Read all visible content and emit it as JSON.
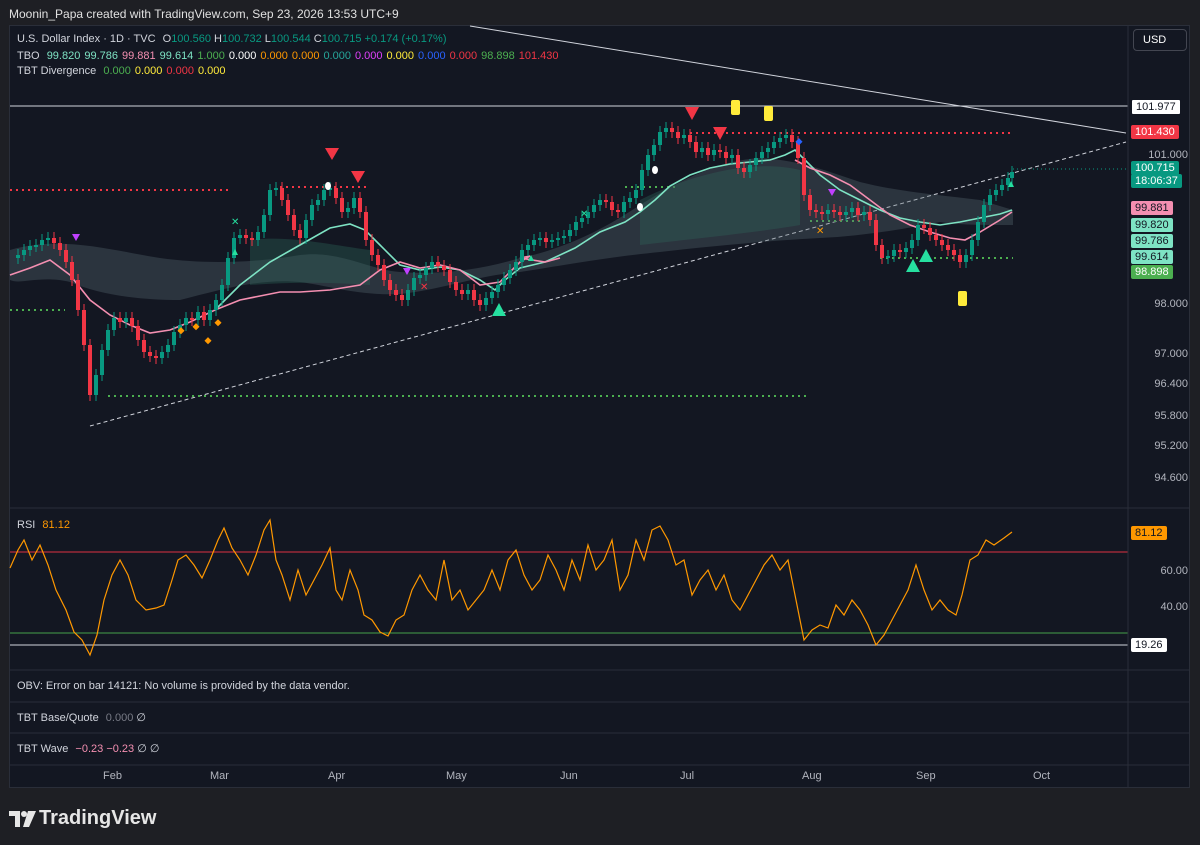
{
  "header": {
    "credit": "Moonin_Papa created with TradingView.com, Sep 23, 2026 13:53 UTC+9"
  },
  "main_legend": {
    "symbol": "U.S. Dollar Index · 1D · TVC",
    "open_label": "O",
    "open": "100.560",
    "high_label": "H",
    "high": "100.732",
    "low_label": "L",
    "low": "100.544",
    "close_label": "C",
    "close": "100.715",
    "change": "+0.174 (+0.17%)"
  },
  "tbo_legend": {
    "name": "TBO",
    "values": [
      {
        "v": "99.820",
        "color": "#7ee3c4"
      },
      {
        "v": "99.786",
        "color": "#7ee3c4"
      },
      {
        "v": "99.881",
        "color": "#f48fb1"
      },
      {
        "v": "99.614",
        "color": "#7ee3c4"
      },
      {
        "v": "1.000",
        "color": "#4caf50"
      },
      {
        "v": "0.000",
        "color": "#ffffff"
      },
      {
        "v": "0.000",
        "color": "#ff9800"
      },
      {
        "v": "0.000",
        "color": "#ff9800"
      },
      {
        "v": "0.000",
        "color": "#26a69a"
      },
      {
        "v": "0.000",
        "color": "#e040fb"
      },
      {
        "v": "0.000",
        "color": "#ffeb3b"
      },
      {
        "v": "0.000",
        "color": "#2962ff"
      },
      {
        "v": "0.000",
        "color": "#f23645"
      },
      {
        "v": "98.898",
        "color": "#4caf50"
      },
      {
        "v": "101.430",
        "color": "#f23645"
      }
    ]
  },
  "div_legend": {
    "name": "TBT Divergence",
    "values": [
      {
        "v": "0.000",
        "color": "#4caf50"
      },
      {
        "v": "0.000",
        "color": "#ffeb3b"
      },
      {
        "v": "0.000",
        "color": "#f23645"
      },
      {
        "v": "0.000",
        "color": "#ffeb3b"
      }
    ]
  },
  "currency_button": "USD",
  "price_scale": [
    "101.000",
    "98.000",
    "97.000",
    "96.400",
    "95.800",
    "95.200",
    "94.600"
  ],
  "price_tags": [
    {
      "v": "101.977",
      "bg": "#ffffff",
      "fg": "#131722",
      "border": "#131722"
    },
    {
      "v": "101.430",
      "bg": "#f23645",
      "fg": "#ffffff",
      "border": "#f23645"
    },
    {
      "v": "100.715",
      "bg": "#089981",
      "fg": "#ffffff",
      "border": "#089981"
    },
    {
      "v": "18:06:37",
      "bg": "#089981",
      "fg": "#ffffff",
      "border": "#089981"
    },
    {
      "v": "99.881",
      "bg": "#f48fb1",
      "fg": "#131722",
      "border": "#f48fb1"
    },
    {
      "v": "99.820",
      "bg": "#7ee3c4",
      "fg": "#131722",
      "border": "#7ee3c4"
    },
    {
      "v": "99.786",
      "bg": "#7ee3c4",
      "fg": "#131722",
      "border": "#7ee3c4"
    },
    {
      "v": "99.614",
      "bg": "#7ee3c4",
      "fg": "#131722",
      "border": "#7ee3c4"
    },
    {
      "v": "98.898",
      "bg": "#4caf50",
      "fg": "#ffffff",
      "border": "#4caf50"
    }
  ],
  "rsi": {
    "name": "RSI",
    "value": "81.12",
    "scale": [
      "60.00",
      "40.00"
    ],
    "low_tag": "19.26",
    "color": "#ff9800"
  },
  "obv": {
    "text": "OBV: Error on bar 14121: No volume is provided by the data vendor."
  },
  "base_quote": {
    "name": "TBT Base/Quote",
    "v1": "0.000",
    "v2": "∅"
  },
  "wave": {
    "name": "TBT Wave",
    "v1": "−0.23",
    "v2": "−0.23",
    "v3": "∅",
    "v4": "∅"
  },
  "time_axis": [
    "Feb",
    "Mar",
    "Apr",
    "May",
    "Jun",
    "Jul",
    "Aug",
    "Sep",
    "Oct"
  ],
  "brand": {
    "name": "TradingView"
  },
  "colors": {
    "up": "#089981",
    "down": "#f23645",
    "ribbon_upper": "#7ee3c4",
    "ribbon_lower": "#f48fb1",
    "rsi": "#ff9800",
    "support": "#4caf50",
    "resistance": "#f23645"
  },
  "chart_data": {
    "type": "candlestick",
    "symbol": "U.S. Dollar Index",
    "timeframe": "1D",
    "y_scale_labels": [
      101.0,
      98.0,
      97.0,
      96.4,
      95.8,
      95.2,
      94.6
    ],
    "horizontal_levels": [
      101.977,
      101.43,
      98.898
    ],
    "last_close": 100.715,
    "rsi_last": 81.12,
    "rsi_min_tag": 19.26
  }
}
